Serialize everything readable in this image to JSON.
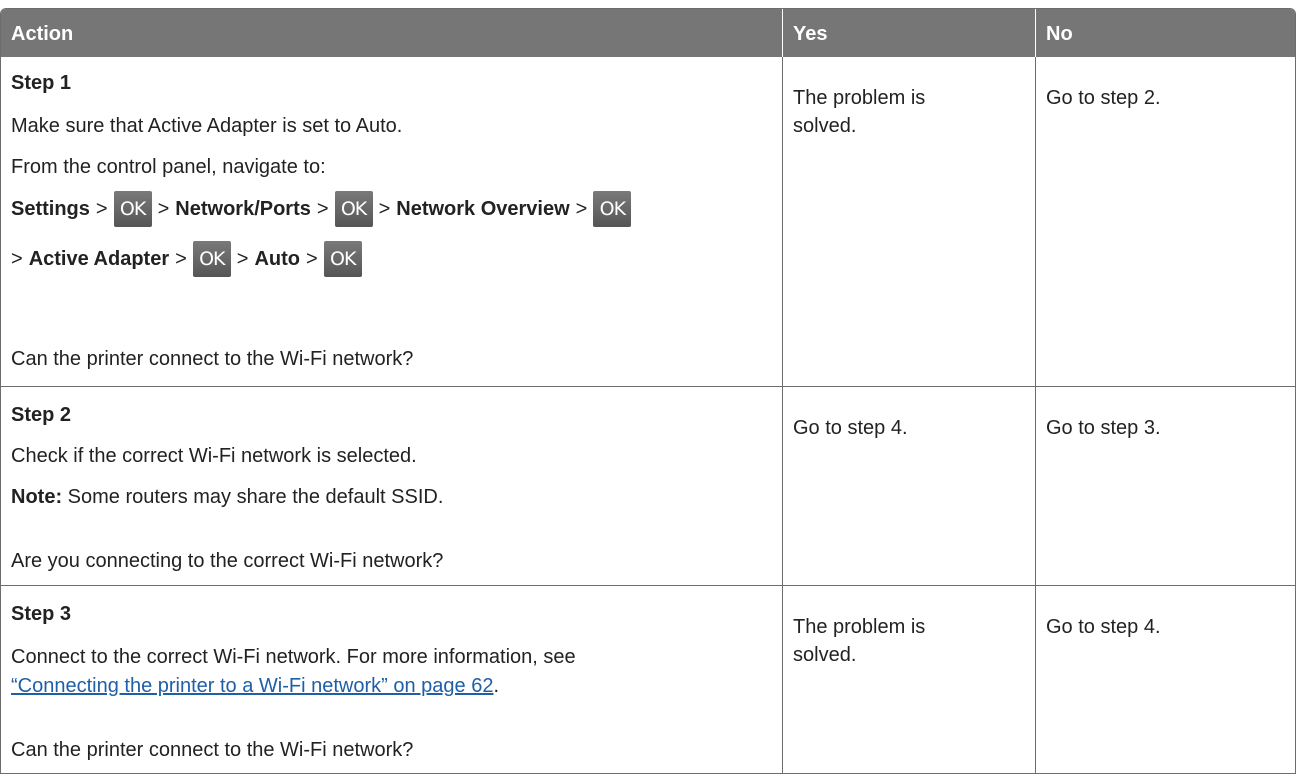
{
  "headers": {
    "action": "Action",
    "yes": "Yes",
    "no": "No"
  },
  "rows": [
    {
      "step": "Step 1",
      "line1": "Make sure that Active Adapter is set to Auto.",
      "line2": "From the control panel, navigate to:",
      "nav": {
        "settings": "Settings",
        "network_ports": "Network/Ports",
        "network_overview": "Network Overview",
        "active_adapter": "Active Adapter",
        "auto": "Auto",
        "sep": ">",
        "ok_label": "OK"
      },
      "question": "Can the printer connect to the Wi-Fi network?",
      "yes_line1": "The problem is",
      "yes_line2": "solved.",
      "no": "Go to step 2."
    },
    {
      "step": "Step 2",
      "line1": "Check if the correct Wi-Fi network is selected.",
      "note_label": "Note:",
      "note_text": " Some routers may share the default SSID.",
      "question": "Are you connecting to the correct Wi-Fi network?",
      "yes": "Go to step 4.",
      "no": "Go to step 3."
    },
    {
      "step": "Step 3",
      "line1": "Connect to the correct Wi-Fi network. For more information, see",
      "link": "“Connecting the printer to a Wi-Fi network” on page 62",
      "link_suffix": ".",
      "question": "Can the printer connect to the Wi-Fi network?",
      "yes_line1": "The problem is",
      "yes_line2": "solved.",
      "no": "Go to step 4."
    }
  ]
}
